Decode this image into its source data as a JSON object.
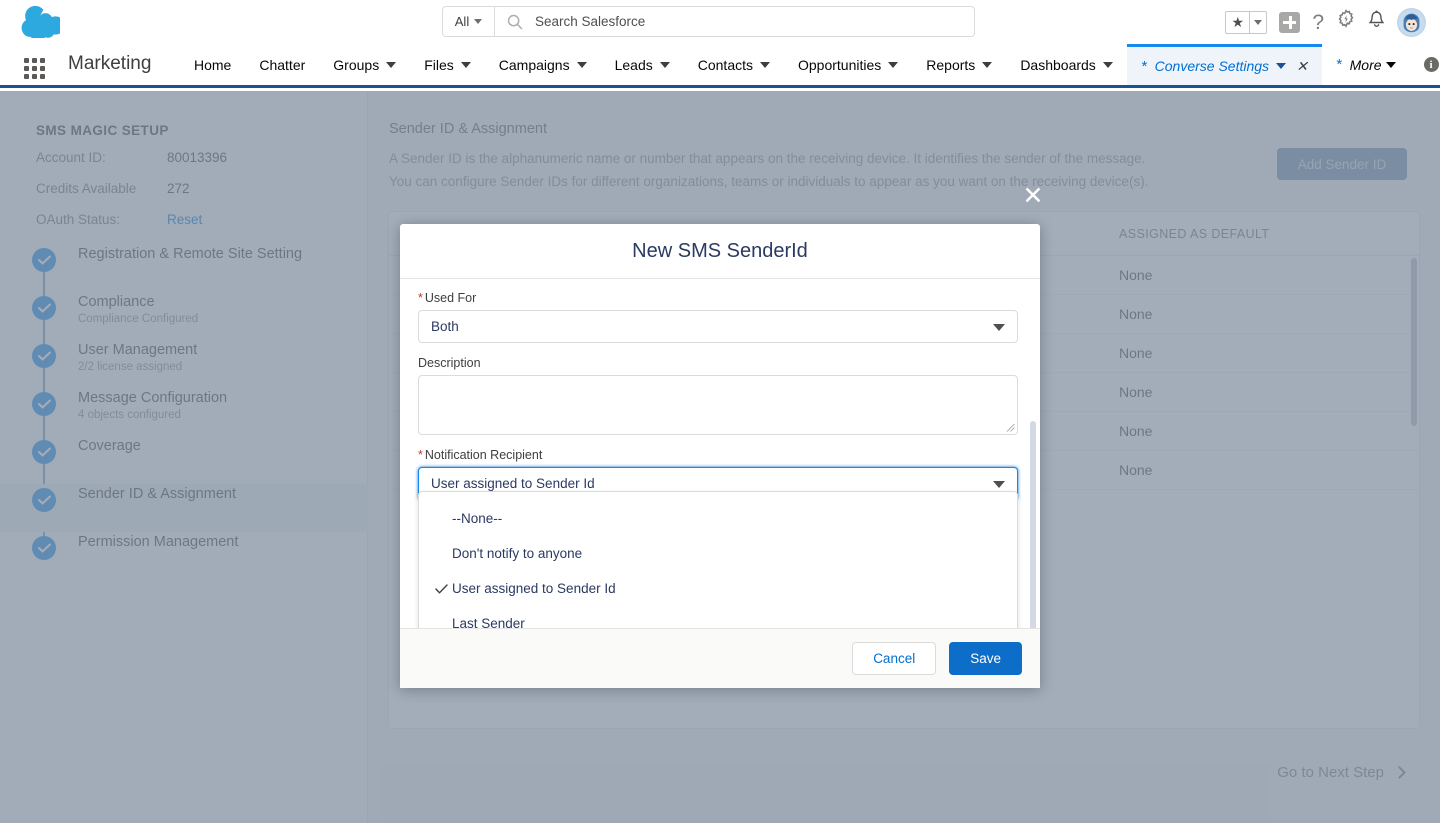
{
  "global_header": {
    "logo_icon": "salesforce-cloud-logo",
    "search": {
      "scope_label": "All",
      "placeholder": "Search Salesforce",
      "icon": "search-icon"
    },
    "icons": [
      {
        "name": "favorites-star-icon",
        "glyph": "★"
      },
      {
        "name": "favorites-dropdown-icon",
        "glyph": "▾"
      },
      {
        "name": "add-icon",
        "glyph": "+"
      },
      {
        "name": "help-icon",
        "glyph": "?"
      },
      {
        "name": "setup-gear-icon",
        "glyph": "⚙"
      },
      {
        "name": "notifications-bell-icon",
        "glyph": "🔔"
      },
      {
        "name": "user-avatar",
        "glyph": ""
      }
    ]
  },
  "app_nav": {
    "app_launcher_icon": "app-launcher-waffle-icon",
    "app_name": "Marketing",
    "items": [
      {
        "label": "Home",
        "has_caret": false
      },
      {
        "label": "Chatter",
        "has_caret": false
      },
      {
        "label": "Groups",
        "has_caret": true
      },
      {
        "label": "Files",
        "has_caret": true
      },
      {
        "label": "Campaigns",
        "has_caret": true
      },
      {
        "label": "Leads",
        "has_caret": true
      },
      {
        "label": "Contacts",
        "has_caret": true
      },
      {
        "label": "Opportunities",
        "has_caret": true
      },
      {
        "label": "Reports",
        "has_caret": true
      },
      {
        "label": "Dashboards",
        "has_caret": true
      }
    ],
    "active_tab": {
      "label": "Converse Settings",
      "unsaved_marker": "*",
      "caret_icon": "chevron-down-icon",
      "close_icon": "close-icon"
    },
    "more": {
      "label": "More",
      "unsaved_marker": "*"
    },
    "info_icon": "info-icon",
    "accent_color": "#1589ee",
    "bar_color": "#1b5297"
  },
  "sidebar": {
    "title": "SMS MAGIC SETUP",
    "fields": [
      {
        "key": "Account ID:",
        "value": "80013396",
        "is_link": false
      },
      {
        "key": "Credits Available",
        "value": "272",
        "is_link": false
      },
      {
        "key": "OAuth Status:",
        "value": "Reset",
        "is_link": true
      }
    ],
    "steps": [
      {
        "title": "Registration & Remote Site Setting",
        "sub": "",
        "selected": false
      },
      {
        "title": "Compliance",
        "sub": "Compliance Configured",
        "selected": false
      },
      {
        "title": "User Management",
        "sub": "2/2 license assigned",
        "selected": false
      },
      {
        "title": "Message Configuration",
        "sub": "4 objects configured",
        "selected": false
      },
      {
        "title": "Coverage",
        "sub": "",
        "selected": false
      },
      {
        "title": "Sender ID & Assignment",
        "sub": "",
        "selected": true
      },
      {
        "title": "Permission Management",
        "sub": "",
        "selected": false
      }
    ]
  },
  "main": {
    "title": "Sender ID & Assignment",
    "description_line1": "A Sender ID is the alphanumeric name or number that appears on the receiving device. It identifies the sender of the message.",
    "description_line2": "You can configure Sender IDs for different organizations, teams or individuals to appear as you want on the receiving device(s).",
    "add_button": "Add Sender ID",
    "table": {
      "columns": [
        "",
        "ASSIGNED AS DEFAULT"
      ],
      "rows": [
        {
          "col1": "",
          "col2": "None"
        },
        {
          "col1": "",
          "col2": "None"
        },
        {
          "col1": "",
          "col2": "None"
        },
        {
          "col1": "",
          "col2": "None"
        },
        {
          "col1": "",
          "col2": "None"
        },
        {
          "col1": "",
          "col2": "None"
        }
      ]
    },
    "next_step": "Go to Next Step",
    "next_step_icon": "chevron-right-icon"
  },
  "overlay": {
    "close_icon": "close-icon",
    "close_glyph": "✕"
  },
  "modal": {
    "title": "New SMS SenderId",
    "fields": {
      "used_for": {
        "label": "Used For",
        "required": true,
        "value": "Both",
        "dropdown_icon": "chevron-down-icon"
      },
      "description": {
        "label": "Description",
        "required": false,
        "value": "",
        "placeholder": ""
      },
      "notification_recipient": {
        "label": "Notification Recipient",
        "required": true,
        "value": "User assigned to Sender Id",
        "dropdown_icon": "chevron-down-icon",
        "expanded": true,
        "options": [
          {
            "label": "--None--",
            "selected": false
          },
          {
            "label": "Don't notify to anyone",
            "selected": false
          },
          {
            "label": "User assigned to Sender Id",
            "selected": true
          },
          {
            "label": "Last Sender",
            "selected": false
          }
        ]
      }
    },
    "footer": {
      "cancel_label": "Cancel",
      "save_label": "Save",
      "save_color": "#0d6ec9"
    }
  }
}
